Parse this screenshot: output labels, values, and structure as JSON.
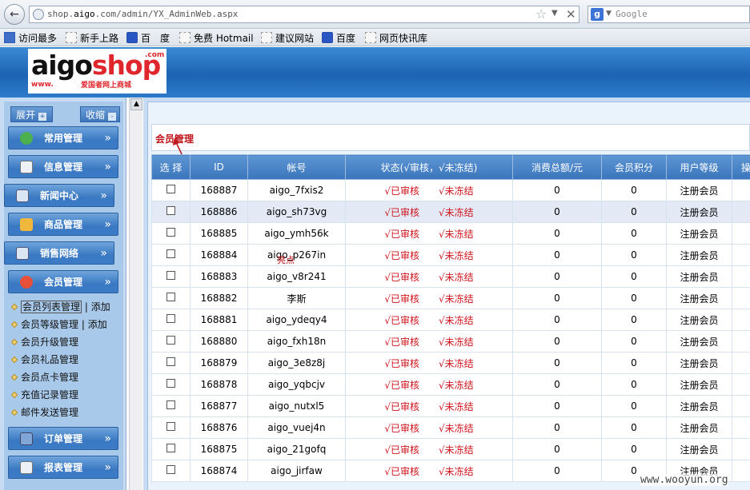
{
  "browser": {
    "url_prefix": "shop.",
    "url_domain": "aigo",
    "url_rest": ".com/admin/YX_AdminWeb.aspx",
    "search_placeholder": "Google"
  },
  "bookmarks": [
    "访问最多",
    "新手上路",
    "百　度",
    "免费 Hotmail",
    "建议网站",
    "百度",
    "网页快讯库"
  ],
  "logo": {
    "brand_a": "aigo",
    "brand_b": "shop",
    "com": ".com",
    "www": "www.",
    "tagline": "爱国者网上商城"
  },
  "sidebar": {
    "expand_label": "展开",
    "collapse_label": "收缩",
    "menus": [
      {
        "label": "常用管理",
        "icon": "globe-icon",
        "color": "#4caf50"
      },
      {
        "label": "信息管理",
        "icon": "document-icon",
        "color": "#e6e6e6"
      },
      {
        "label": "新闻中心",
        "icon": "news-icon",
        "color": "#d5e3f3"
      },
      {
        "label": "商品管理",
        "icon": "box-icon",
        "color": "#f0b83c"
      },
      {
        "label": "销售网络",
        "icon": "network-icon",
        "color": "#d5e3f3"
      },
      {
        "label": "会员管理",
        "icon": "member-icon",
        "color": "#e8503a"
      }
    ],
    "sub_items": [
      {
        "label": "会员列表管理",
        "extra": "添加"
      },
      {
        "label": "会员等级管理",
        "extra": "添加"
      },
      {
        "label": "会员升级管理",
        "extra": ""
      },
      {
        "label": "会员礼品管理",
        "extra": ""
      },
      {
        "label": "会员点卡管理",
        "extra": ""
      },
      {
        "label": "充值记录管理",
        "extra": ""
      },
      {
        "label": "邮件发送管理",
        "extra": ""
      }
    ],
    "bottom_menus": [
      {
        "label": "订单管理",
        "icon": "cart-icon",
        "color": "#7fa6d6"
      },
      {
        "label": "报表管理",
        "icon": "report-icon",
        "color": "#e6e6e6"
      }
    ]
  },
  "page_title": "会员管理",
  "annotation": "亮点",
  "table": {
    "headers": [
      "选 择",
      "ID",
      "帐号",
      "状态(√审核，√未冻结)",
      "消费总额/元",
      "会员积分",
      "用户等级",
      "操"
    ],
    "status_a": "√已审核",
    "status_b": "√未冻结",
    "rows": [
      {
        "id": "168887",
        "account": "aigo_7fxis2",
        "total": "0",
        "points": "0",
        "level": "注册会员"
      },
      {
        "id": "168886",
        "account": "aigo_sh73vg",
        "total": "0",
        "points": "0",
        "level": "注册会员"
      },
      {
        "id": "168885",
        "account": "aigo_ymh56k",
        "total": "0",
        "points": "0",
        "level": "注册会员"
      },
      {
        "id": "168884",
        "account": "aigo_p267in",
        "total": "0",
        "points": "0",
        "level": "注册会员"
      },
      {
        "id": "168883",
        "account": "aigo_v8r241",
        "total": "0",
        "points": "0",
        "level": "注册会员"
      },
      {
        "id": "168882",
        "account": "李斯",
        "total": "0",
        "points": "0",
        "level": "注册会员"
      },
      {
        "id": "168881",
        "account": "aigo_ydeqy4",
        "total": "0",
        "points": "0",
        "level": "注册会员"
      },
      {
        "id": "168880",
        "account": "aigo_fxh18n",
        "total": "0",
        "points": "0",
        "level": "注册会员"
      },
      {
        "id": "168879",
        "account": "aigo_3e8z8j",
        "total": "0",
        "points": "0",
        "level": "注册会员"
      },
      {
        "id": "168878",
        "account": "aigo_yqbcjv",
        "total": "0",
        "points": "0",
        "level": "注册会员"
      },
      {
        "id": "168877",
        "account": "aigo_nutxl5",
        "total": "0",
        "points": "0",
        "level": "注册会员"
      },
      {
        "id": "168876",
        "account": "aigo_vuej4n",
        "total": "0",
        "points": "0",
        "level": "注册会员"
      },
      {
        "id": "168875",
        "account": "aigo_21gofq",
        "total": "0",
        "points": "0",
        "level": "注册会员"
      },
      {
        "id": "168874",
        "account": "aigo_jirfaw",
        "total": "0",
        "points": "0",
        "level": "注册会员"
      }
    ]
  },
  "watermark": "www.wooyun.org"
}
